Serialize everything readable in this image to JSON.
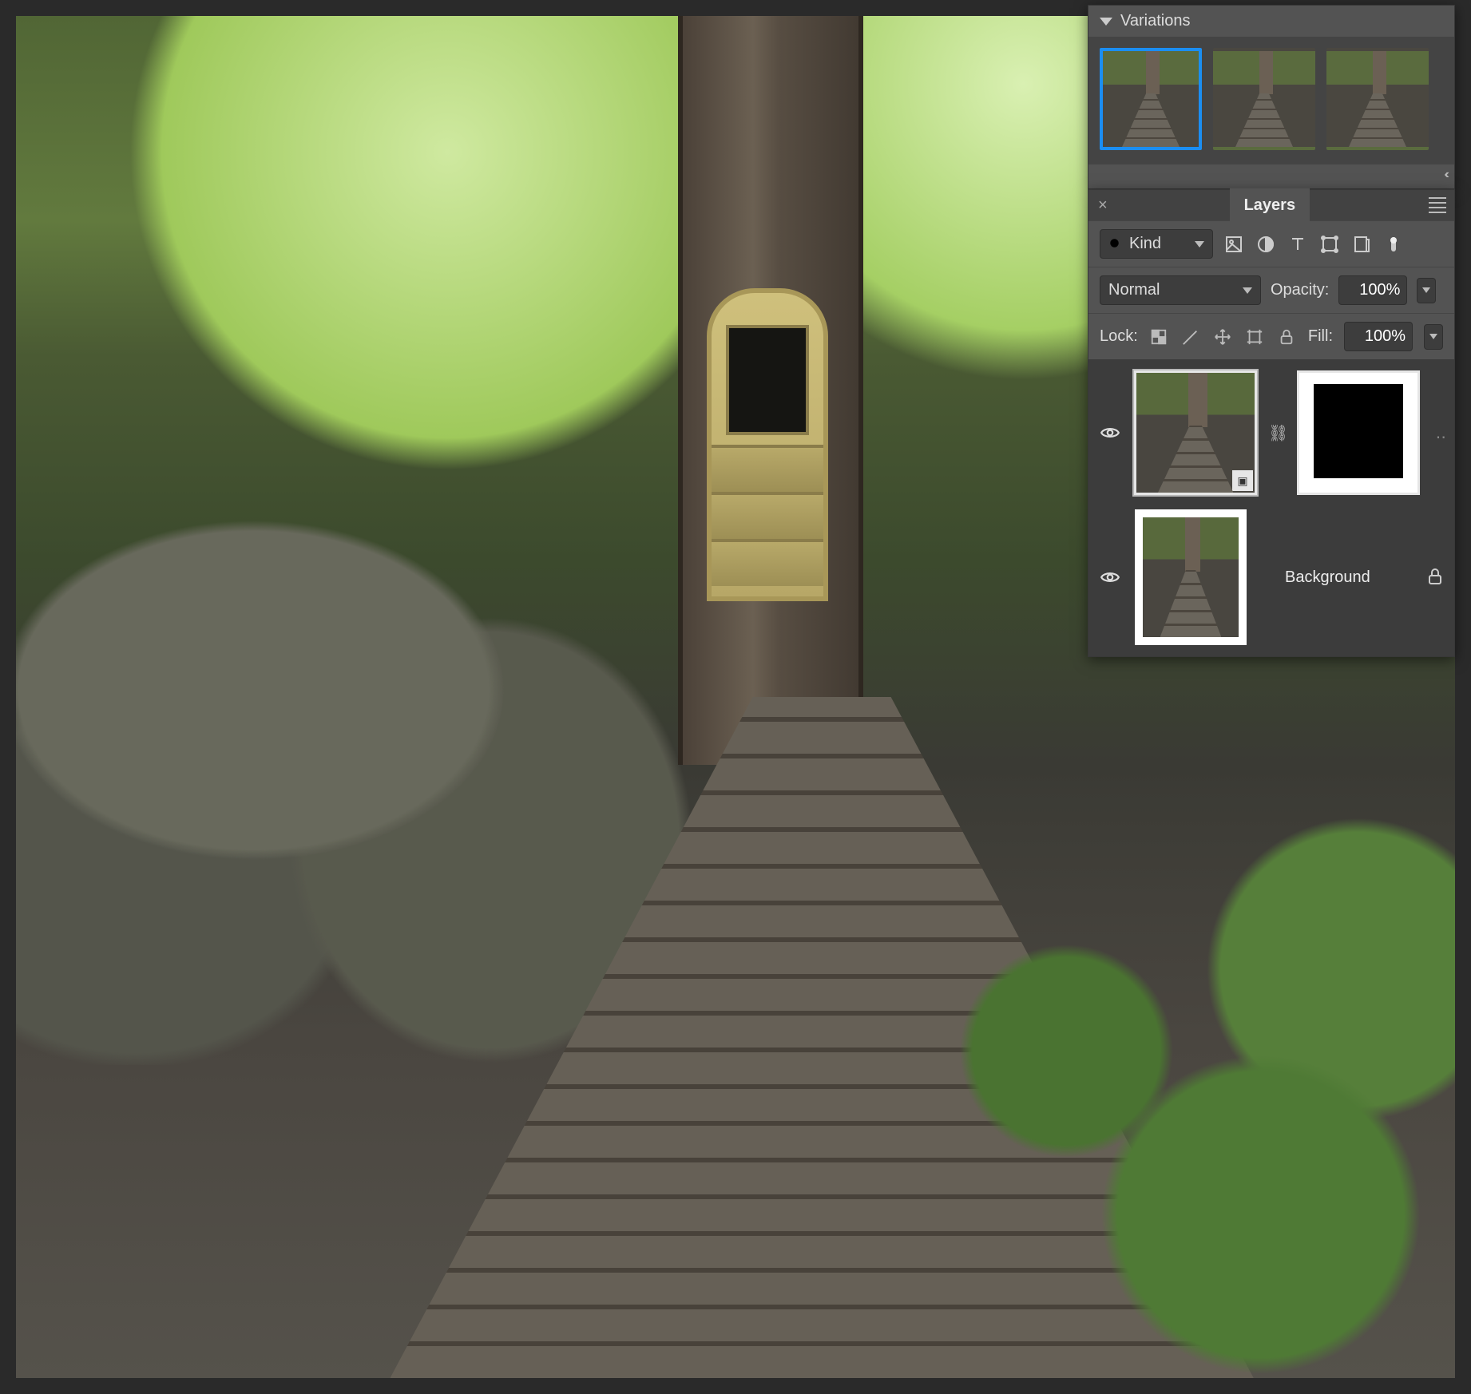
{
  "variations": {
    "title": "Variations",
    "count": 3,
    "selected_index": 0
  },
  "layers_panel": {
    "tab": "Layers",
    "filter": {
      "mode": "Kind",
      "icons": [
        "image-filter",
        "adjustment-filter",
        "type-filter",
        "shape-filter",
        "smartobject-filter"
      ]
    },
    "blend_mode": "Normal",
    "opacity_label": "Opacity:",
    "opacity_value": "100%",
    "lock_label": "Lock:",
    "lock_icons": [
      "transparency-lock",
      "brush-lock",
      "position-lock",
      "artboard-lock",
      "all-lock"
    ],
    "fill_label": "Fill:",
    "fill_value": "100%",
    "layers": [
      {
        "visible": true,
        "type": "smart-object",
        "linked": true,
        "has_mask": true,
        "name": ""
      },
      {
        "visible": true,
        "type": "background",
        "name": "Background",
        "locked": true
      }
    ]
  }
}
